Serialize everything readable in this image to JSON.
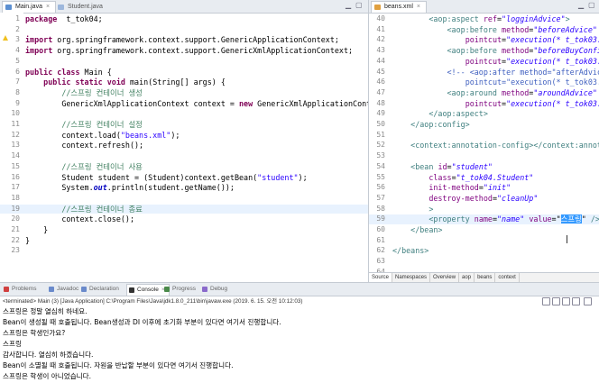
{
  "left_editor": {
    "tabs": [
      {
        "label": "Main.java",
        "active": true
      },
      {
        "label": "Student.java",
        "active": false
      }
    ],
    "lines": [
      {
        "n": "1",
        "t": [
          [
            "kw",
            "package"
          ],
          [
            "",
            "  t_tok04;"
          ]
        ]
      },
      {
        "n": "2",
        "t": []
      },
      {
        "n": "3",
        "t": [
          [
            "kw",
            "import"
          ],
          [
            "",
            " org.springframework.context.support.GenericApplicationContext;"
          ]
        ]
      },
      {
        "n": "4",
        "t": [
          [
            "kw",
            "import"
          ],
          [
            "",
            " org.springframework.context.support.GenericXmlApplicationContext;"
          ]
        ]
      },
      {
        "n": "5",
        "t": []
      },
      {
        "n": "6",
        "t": [
          [
            "kw",
            "public class"
          ],
          [
            "",
            " Main {"
          ]
        ]
      },
      {
        "n": "7",
        "t": [
          [
            "",
            "    "
          ],
          [
            "kw",
            "public static void"
          ],
          [
            "",
            " main(String[] args) {"
          ]
        ]
      },
      {
        "n": "8",
        "t": [
          [
            "",
            "        "
          ],
          [
            "cm",
            "//스프링 컨테이너 생성"
          ]
        ]
      },
      {
        "n": "9",
        "t": [
          [
            "",
            "        GenericXmlApplicationContext context = "
          ],
          [
            "kw",
            "new"
          ],
          [
            "",
            " GenericXmlApplicationConte"
          ]
        ]
      },
      {
        "n": "10",
        "t": []
      },
      {
        "n": "11",
        "t": [
          [
            "",
            "        "
          ],
          [
            "cm",
            "//스프링 컨테이너 설정"
          ]
        ]
      },
      {
        "n": "12",
        "t": [
          [
            "",
            "        context.load("
          ],
          [
            "str",
            "\"beans.xml\""
          ],
          [
            "",
            ");"
          ]
        ]
      },
      {
        "n": "13",
        "t": [
          [
            "",
            "        context.refresh();"
          ]
        ]
      },
      {
        "n": "14",
        "t": []
      },
      {
        "n": "15",
        "t": [
          [
            "",
            "        "
          ],
          [
            "cm",
            "//스프링 컨테이너 사용"
          ]
        ]
      },
      {
        "n": "16",
        "t": [
          [
            "",
            "        Student student = (Student)context.getBean("
          ],
          [
            "str",
            "\"student\""
          ],
          [
            "",
            ");"
          ]
        ]
      },
      {
        "n": "17",
        "t": [
          [
            "",
            "        System."
          ],
          [
            "fld",
            "out"
          ],
          [
            "",
            ".println(student.getName());"
          ]
        ]
      },
      {
        "n": "18",
        "t": []
      },
      {
        "n": "19",
        "t": [
          [
            "",
            "        "
          ],
          [
            "cm",
            "//스프링 컨테이너 종료"
          ]
        ]
      },
      {
        "n": "20",
        "t": [
          [
            "",
            "        context.close();"
          ]
        ]
      },
      {
        "n": "21",
        "t": [
          [
            "",
            "    }"
          ]
        ]
      },
      {
        "n": "22",
        "t": [
          [
            "",
            "}"
          ]
        ]
      },
      {
        "n": "23",
        "t": []
      }
    ]
  },
  "right_editor": {
    "tabs": [
      {
        "label": "beans.xml",
        "active": true
      }
    ],
    "lines": [
      {
        "n": "40",
        "t": [
          [
            "",
            "        "
          ],
          [
            "tag",
            "<aop:aspect"
          ],
          [
            "",
            " "
          ],
          [
            "attr",
            "ref"
          ],
          [
            "",
            "="
          ],
          [
            "aval",
            "\"logginAdvice\""
          ],
          [
            "tag",
            ">"
          ]
        ]
      },
      {
        "n": "41",
        "t": [
          [
            "",
            "            "
          ],
          [
            "tag",
            "<aop:before"
          ],
          [
            "",
            " "
          ],
          [
            "attr",
            "method"
          ],
          [
            "",
            "="
          ],
          [
            "aval",
            "\"beforeAdvice\""
          ]
        ]
      },
      {
        "n": "42",
        "t": [
          [
            "",
            "                "
          ],
          [
            "attr",
            "pointcut"
          ],
          [
            "",
            "="
          ],
          [
            "aval",
            "\"execution(* t_tok03.It"
          ]
        ]
      },
      {
        "n": "43",
        "t": [
          [
            "",
            "            "
          ],
          [
            "tag",
            "<aop:before"
          ],
          [
            "",
            " "
          ],
          [
            "attr",
            "method"
          ],
          [
            "",
            "="
          ],
          [
            "aval",
            "\"beforeBuyConfirm"
          ]
        ]
      },
      {
        "n": "44",
        "t": [
          [
            "",
            "                "
          ],
          [
            "attr",
            "pointcut"
          ],
          [
            "",
            "="
          ],
          [
            "aval",
            "\"execution(* t_tok03.It"
          ]
        ]
      },
      {
        "n": "45",
        "t": [
          [
            "",
            "            "
          ],
          [
            "xcm",
            "<!-- <aop:after method=\"afterAdvice\""
          ]
        ]
      },
      {
        "n": "46",
        "t": [
          [
            "",
            "                "
          ],
          [
            "xcm",
            "pointcut=\"execution(* t_tok03.*T"
          ]
        ]
      },
      {
        "n": "47",
        "t": [
          [
            "",
            "            "
          ],
          [
            "tag",
            "<aop:around"
          ],
          [
            "",
            " "
          ],
          [
            "attr",
            "method"
          ],
          [
            "",
            "="
          ],
          [
            "aval",
            "\"aroundAdvice\""
          ]
        ]
      },
      {
        "n": "48",
        "t": [
          [
            "",
            "                "
          ],
          [
            "attr",
            "pointcut"
          ],
          [
            "",
            "="
          ],
          [
            "aval",
            "\"execution(* t_tok03.*T"
          ]
        ]
      },
      {
        "n": "49",
        "t": [
          [
            "",
            "        "
          ],
          [
            "tag",
            "</aop:aspect>"
          ]
        ]
      },
      {
        "n": "50",
        "t": [
          [
            "",
            "    "
          ],
          [
            "tag",
            "</aop:config>"
          ]
        ]
      },
      {
        "n": "51",
        "t": []
      },
      {
        "n": "52",
        "t": [
          [
            "",
            "    "
          ],
          [
            "tag",
            "<context:annotation-config>"
          ],
          [
            "tag",
            "</context:annotat"
          ]
        ]
      },
      {
        "n": "53",
        "t": []
      },
      {
        "n": "54",
        "t": [
          [
            "",
            "    "
          ],
          [
            "tag",
            "<bean"
          ],
          [
            "",
            " "
          ],
          [
            "attr",
            "id"
          ],
          [
            "",
            "="
          ],
          [
            "aval",
            "\"student\""
          ]
        ]
      },
      {
        "n": "55",
        "t": [
          [
            "",
            "        "
          ],
          [
            "attr",
            "class"
          ],
          [
            "",
            "="
          ],
          [
            "aval",
            "\"t_tok04.Student\""
          ]
        ]
      },
      {
        "n": "56",
        "t": [
          [
            "",
            "        "
          ],
          [
            "attr",
            "init-method"
          ],
          [
            "",
            "="
          ],
          [
            "aval",
            "\"init\""
          ]
        ]
      },
      {
        "n": "57",
        "t": [
          [
            "",
            "        "
          ],
          [
            "attr",
            "destroy-method"
          ],
          [
            "",
            "="
          ],
          [
            "aval",
            "\"cleanUp\""
          ]
        ]
      },
      {
        "n": "58",
        "t": [
          [
            "",
            "        "
          ],
          [
            "tag",
            ">"
          ]
        ]
      },
      {
        "n": "59",
        "t": [
          [
            "",
            "        "
          ],
          [
            "tag",
            "<property"
          ],
          [
            "",
            " "
          ],
          [
            "attr",
            "name"
          ],
          [
            "",
            "="
          ],
          [
            "aval",
            "\"name\""
          ],
          [
            "",
            " "
          ],
          [
            "attr",
            "value"
          ],
          [
            "",
            "=\""
          ],
          [
            "sel",
            "스프링"
          ],
          [
            "",
            "\" "
          ],
          [
            "tag",
            "/>"
          ]
        ]
      },
      {
        "n": "60",
        "t": [
          [
            "",
            "    "
          ],
          [
            "tag",
            "</bean>"
          ]
        ]
      },
      {
        "n": "61",
        "t": []
      },
      {
        "n": "62",
        "t": [
          [
            "tag",
            "</beans>"
          ]
        ]
      },
      {
        "n": "63",
        "t": []
      },
      {
        "n": "64",
        "t": []
      },
      {
        "n": "65",
        "t": []
      }
    ],
    "bottom_tabs": [
      "Source",
      "Namespaces",
      "Overview",
      "aop",
      "beans",
      "context"
    ]
  },
  "console": {
    "tabs": [
      "Problems",
      "Javadoc",
      "Declaration",
      "Console",
      "Progress",
      "Debug"
    ],
    "active_tab": "Console",
    "status": "<terminated> Main (3) [Java Application] C:\\Program Files\\Java\\jdk1.8.0_211\\bin\\javaw.exe (2019. 6. 15. 오전 10:12:03)",
    "lines": [
      "스프링은 정말 열심히 하네요.",
      "Bean이 생성될 때 호출됩니다.  Bean생성과 DI 이후에 초기화 부분이 있다면 여기서 진행합니다.",
      "스프링은 학생인가요?",
      "스프링",
      "감사합니다. 열심히 하겠습니다.",
      "Bean이 소멸될 때 호출됩니다.  자원을 반납할 부분이 있다면 여기서 진행합니다.",
      "스프링은 학생이 아니었습니다."
    ]
  }
}
